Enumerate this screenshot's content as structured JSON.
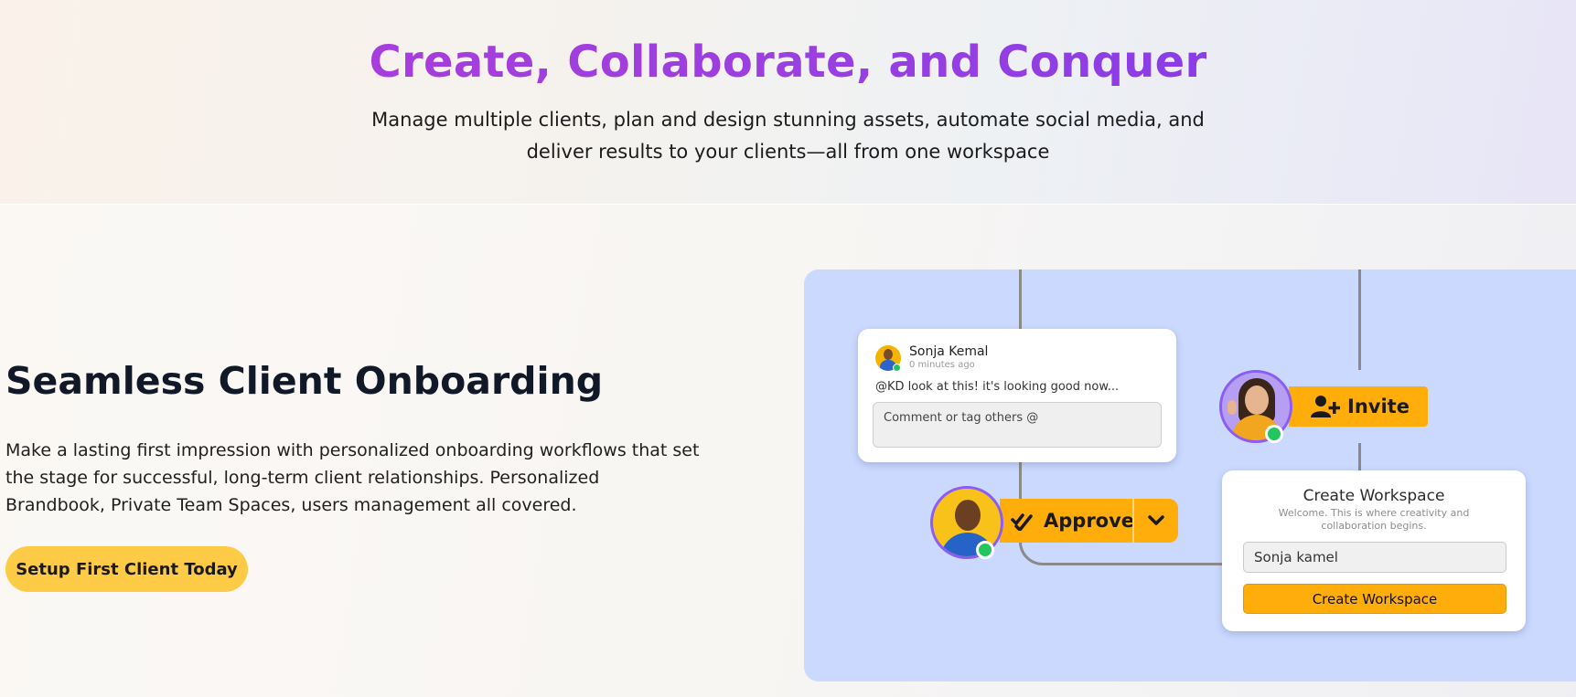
{
  "hero": {
    "title": "Create, Collaborate, and Conquer",
    "subtitle": "Manage multiple clients, plan and design stunning assets, automate social media, and deliver results to your clients—all from one workspace"
  },
  "feature": {
    "title": "Seamless Client Onboarding",
    "description": "Make a lasting first impression with personalized onboarding workflows that set the stage for successful, long-term client relationships. Personalized Brandbook, Private Team Spaces, users management  all covered.",
    "cta_label": "Setup First Client Today"
  },
  "illustration": {
    "comment": {
      "author": "Sonja Kemal",
      "time": "0 minutes ago",
      "text": "@KD look at this! it's looking good now...",
      "input_placeholder": "Comment or tag others @"
    },
    "approve_label": "Approve",
    "invite_label": "Invite",
    "workspace": {
      "title": "Create Workspace",
      "subtitle": "Welcome. This is where creativity and collaboration begins.",
      "name_value": "Sonja kamel",
      "button_label": "Create Workspace"
    }
  },
  "colors": {
    "accent": "#ffad0b",
    "cta": "#fdcb45",
    "panel": "#cbd9ff",
    "title_gradient_start": "#b23bd8",
    "title_gradient_end": "#7c3aed",
    "online": "#22c55e"
  }
}
